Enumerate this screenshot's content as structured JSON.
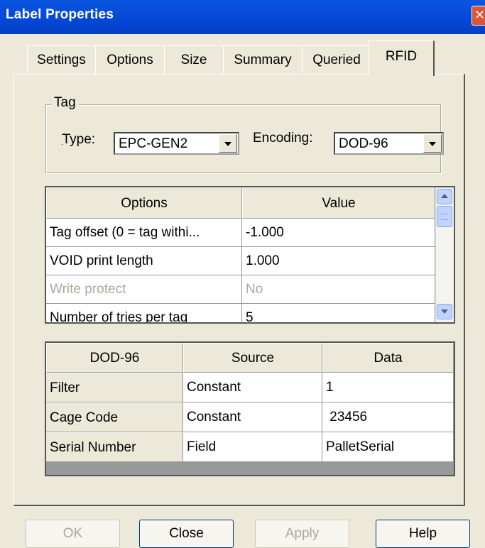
{
  "window": {
    "title": "Label Properties",
    "close_glyph": "✕"
  },
  "tabs": [
    {
      "label": "Settings"
    },
    {
      "label": "Options"
    },
    {
      "label": "Size"
    },
    {
      "label": "Summary"
    },
    {
      "label": "Queried"
    },
    {
      "label": "RFID",
      "active": true
    }
  ],
  "tag_group": {
    "title": "Tag",
    "type_label": "Type:",
    "type_value": "EPC-GEN2",
    "encoding_label": "Encoding:",
    "encoding_value": "DOD-96"
  },
  "options_grid": {
    "headers": [
      "Options",
      "Value"
    ],
    "rows": [
      {
        "option": "Tag offset (0 = tag withi...",
        "value": "-1.000",
        "disabled": false
      },
      {
        "option": "VOID print length",
        "value": "1.000",
        "disabled": false
      },
      {
        "option": "Write protect",
        "value": "No",
        "disabled": true
      },
      {
        "option": "Number of tries per tag",
        "value": "5",
        "disabled": false
      }
    ]
  },
  "encoding_grid": {
    "headers": [
      "DOD-96",
      "Source",
      "Data"
    ],
    "rows": [
      {
        "field": "Filter",
        "source": "Constant",
        "data": "1"
      },
      {
        "field": "Cage Code",
        "source": "Constant",
        "data": " 23456"
      },
      {
        "field": "Serial Number",
        "source": "Field",
        "data": "PalletSerial"
      }
    ]
  },
  "buttons": {
    "ok": "OK",
    "close": "Close",
    "apply": "Apply",
    "help": "Help"
  }
}
